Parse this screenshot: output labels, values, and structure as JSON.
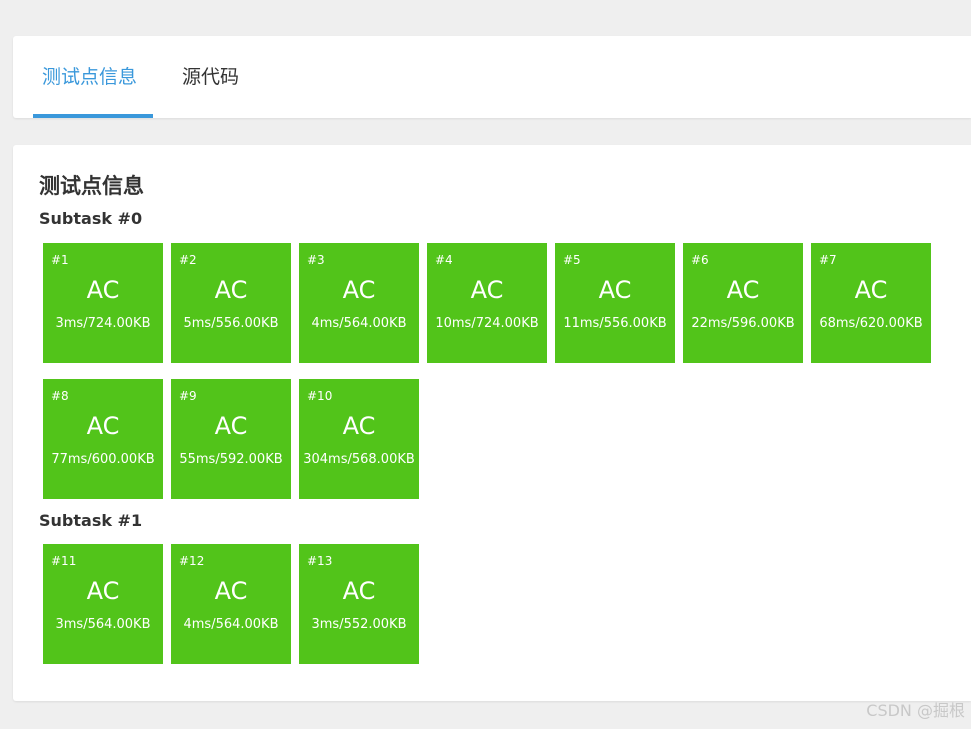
{
  "tabs": [
    {
      "label": "测试点信息",
      "active": true
    },
    {
      "label": "源代码",
      "active": false
    }
  ],
  "section_title": "测试点信息",
  "subtasks": [
    {
      "title": "Subtask #0",
      "cases": [
        {
          "id": "#1",
          "status": "AC",
          "stats": "3ms/724.00KB"
        },
        {
          "id": "#2",
          "status": "AC",
          "stats": "5ms/556.00KB"
        },
        {
          "id": "#3",
          "status": "AC",
          "stats": "4ms/564.00KB"
        },
        {
          "id": "#4",
          "status": "AC",
          "stats": "10ms/724.00KB"
        },
        {
          "id": "#5",
          "status": "AC",
          "stats": "11ms/556.00KB"
        },
        {
          "id": "#6",
          "status": "AC",
          "stats": "22ms/596.00KB"
        },
        {
          "id": "#7",
          "status": "AC",
          "stats": "68ms/620.00KB"
        },
        {
          "id": "#8",
          "status": "AC",
          "stats": "77ms/600.00KB"
        },
        {
          "id": "#9",
          "status": "AC",
          "stats": "55ms/592.00KB"
        },
        {
          "id": "#10",
          "status": "AC",
          "stats": "304ms/568.00KB"
        }
      ]
    },
    {
      "title": "Subtask #1",
      "cases": [
        {
          "id": "#11",
          "status": "AC",
          "stats": "3ms/564.00KB"
        },
        {
          "id": "#12",
          "status": "AC",
          "stats": "4ms/564.00KB"
        },
        {
          "id": "#13",
          "status": "AC",
          "stats": "3ms/552.00KB"
        }
      ]
    }
  ],
  "colors": {
    "accent": "#3a98db",
    "accepted": "#52c41a"
  },
  "watermark": "CSDN @掘根"
}
